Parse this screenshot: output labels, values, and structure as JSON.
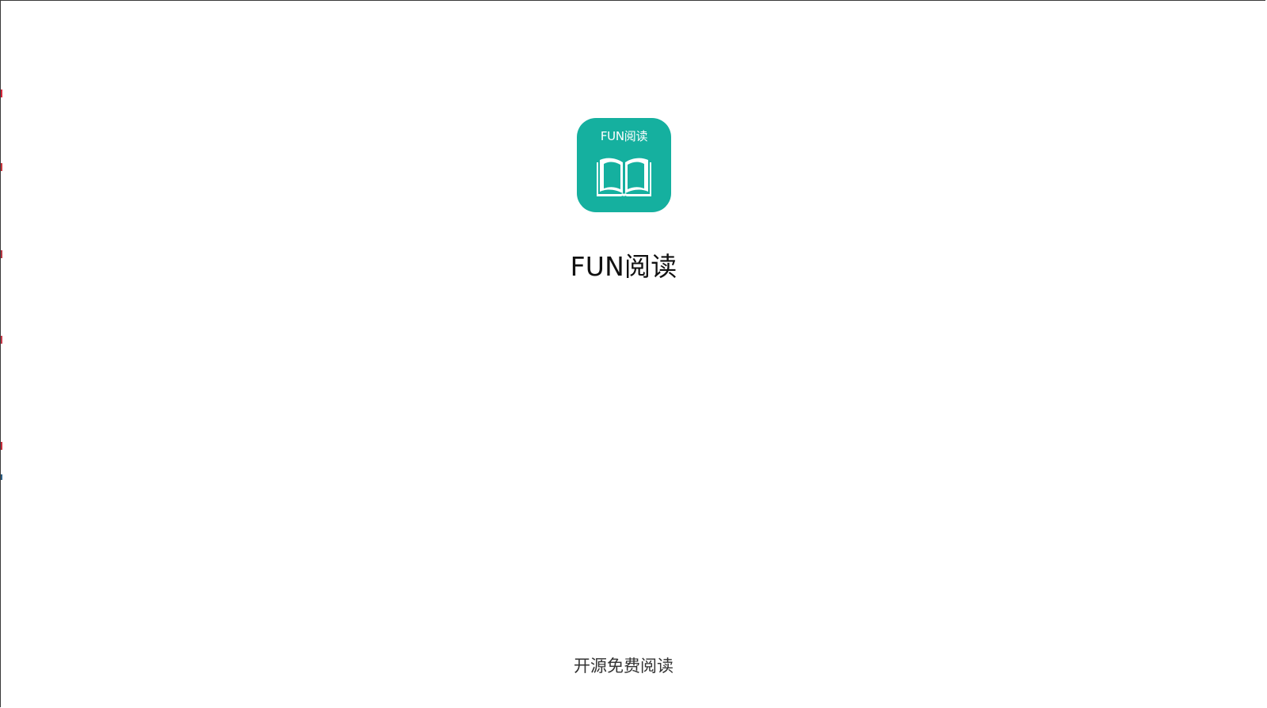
{
  "splash": {
    "icon_label": "FUN阅读",
    "app_title": "FUN阅读",
    "tagline": "开源免费阅读",
    "icon_name": "open-book-icon"
  },
  "colors": {
    "brand": "#15b09f",
    "background": "#ffffff",
    "title_text": "#111111",
    "tagline_text": "#333333",
    "window_border": "#3a3a3a"
  }
}
